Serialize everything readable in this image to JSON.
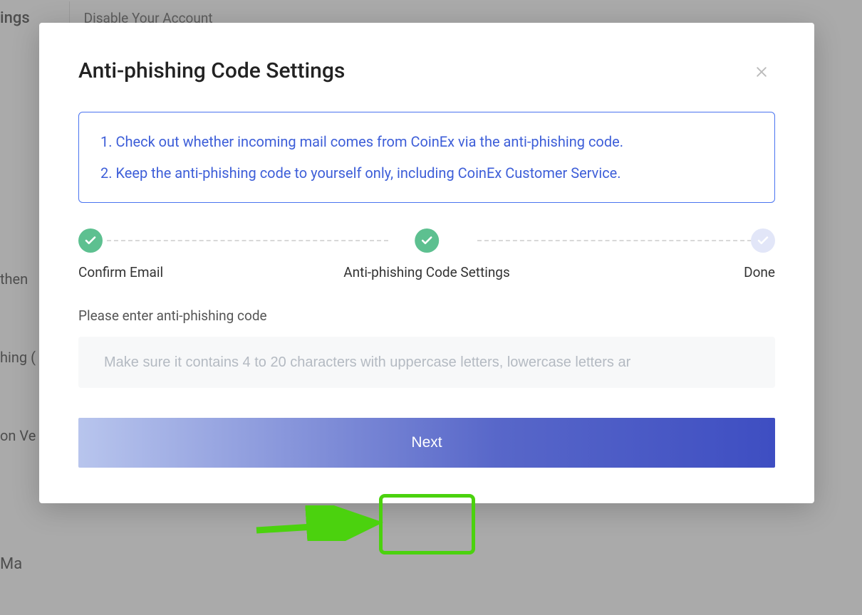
{
  "background": {
    "tab_settings": "ings",
    "tab_disable": "Disable Your Account",
    "side_items": [
      "then",
      "hing (",
      "on Ve",
      "  Ma"
    ]
  },
  "modal": {
    "title": "Anti-phishing Code Settings",
    "info_line1": "1. Check out whether incoming mail comes from CoinEx via the anti-phishing code.",
    "info_line2": "2. Keep the anti-phishing code to yourself only, including CoinEx Customer Service.",
    "steps": {
      "step1": "Confirm Email",
      "step2": "Anti-phishing Code Settings",
      "step3": "Done"
    },
    "input_label": "Please enter anti-phishing code",
    "input_placeholder": "Make sure it contains 4 to 20 characters with uppercase letters, lowercase letters ar",
    "next_button": "Next"
  }
}
